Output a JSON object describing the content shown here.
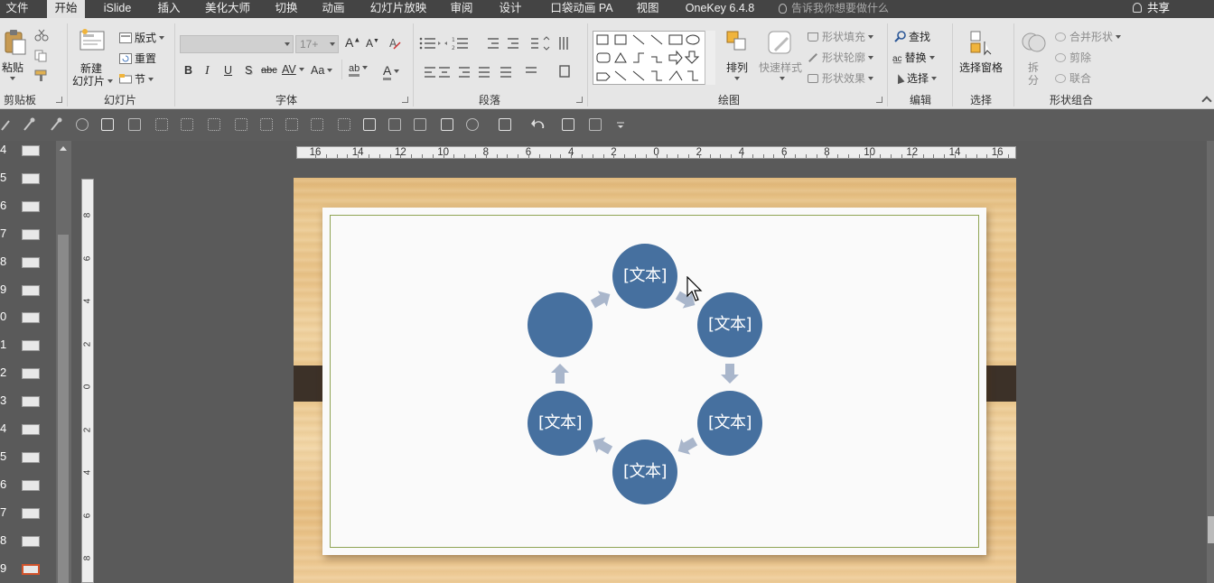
{
  "menu": {
    "tabs": [
      "文件",
      "开始",
      "iSlide",
      "插入",
      "美化大师",
      "切换",
      "动画",
      "幻灯片放映",
      "审阅",
      "设计",
      "口袋动画 PA",
      "视图",
      "OneKey 6.4.8"
    ],
    "active_tab": "开始",
    "tell_me": "告诉我你想要做什么",
    "share": "共享"
  },
  "ribbon": {
    "clipboard": {
      "label": "剪贴板",
      "paste": "粘贴"
    },
    "slides": {
      "label": "幻灯片",
      "new_slide_line1": "新建",
      "new_slide_line2": "幻灯片",
      "layout": "版式",
      "reset": "重置",
      "section": "节"
    },
    "font": {
      "label": "字体",
      "font_name": "",
      "font_size": "17+",
      "grow": "A",
      "shrink": "A",
      "bold": "B",
      "italic": "I",
      "underline": "U",
      "shadow": "S",
      "strike": "abc",
      "spacing": "AV",
      "case": "Aa",
      "highlight": "ab",
      "color": "A"
    },
    "paragraph": {
      "label": "段落"
    },
    "drawing": {
      "label": "绘图",
      "arrange": "排列",
      "quick_styles": "快速样式",
      "shape_fill": "形状填充",
      "shape_outline": "形状轮廓",
      "shape_effects": "形状效果"
    },
    "editing": {
      "label": "编辑",
      "find": "查找",
      "replace": "替换",
      "select": "选择"
    },
    "selection": {
      "label": "选择",
      "selection_pane": "选择窗格"
    },
    "shape_combine": {
      "label": "形状组合",
      "split_line1": "拆",
      "split_line2": "分",
      "merge": "合并形状",
      "cut": "剪除",
      "union": "联合"
    }
  },
  "thumbnails": {
    "numbers": [
      "4",
      "5",
      "6",
      "7",
      "8",
      "9",
      "0",
      "1",
      "2",
      "3",
      "4",
      "5",
      "6",
      "7",
      "8",
      "9"
    ],
    "selected_index": 15
  },
  "rulers": {
    "horizontal": [
      "16",
      "14",
      "12",
      "10",
      "8",
      "6",
      "4",
      "2",
      "0",
      "2",
      "4",
      "6",
      "8",
      "10",
      "12",
      "14",
      "16"
    ],
    "vertical": [
      "8",
      "6",
      "4",
      "2",
      "0",
      "2",
      "4",
      "6",
      "8"
    ]
  },
  "slide": {
    "node_text": "[文本]",
    "nodes": [
      {
        "name": "top",
        "text": "[文本]"
      },
      {
        "name": "upper-right",
        "text": "[文本]"
      },
      {
        "name": "lower-right",
        "text": "[文本]"
      },
      {
        "name": "bottom",
        "text": "[文本]"
      },
      {
        "name": "lower-left",
        "text": "[文本]"
      },
      {
        "name": "upper-left",
        "text": ""
      }
    ],
    "colors": {
      "node": "#46709f",
      "arrow": "#a9b6cb",
      "frame": "#8fa454",
      "clip": "#3c3128"
    }
  }
}
